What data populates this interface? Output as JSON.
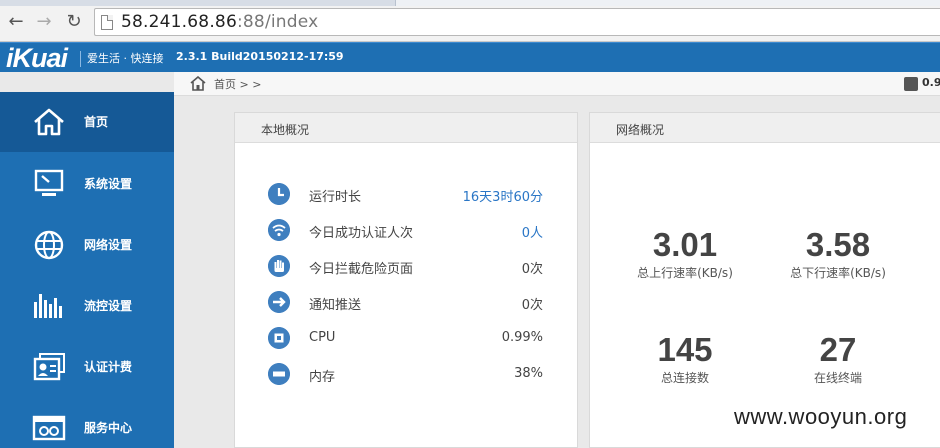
{
  "browser": {
    "url_host": "58.241.68.86",
    "url_port": ":88",
    "url_path": "/index"
  },
  "header": {
    "logo": "iKuai",
    "slogan": "爱生活 · 快连接",
    "build": "2.3.1 Build20150212-17:59"
  },
  "breadcrumb": {
    "text": "首页 > >",
    "cpu_value": "0.9"
  },
  "sidebar": {
    "items": [
      {
        "label": "首页",
        "icon": "home-icon"
      },
      {
        "label": "系统设置",
        "icon": "monitor-icon"
      },
      {
        "label": "网络设置",
        "icon": "globe-icon"
      },
      {
        "label": "流控设置",
        "icon": "bar-chart-icon"
      },
      {
        "label": "认证计费",
        "icon": "id-card-icon"
      },
      {
        "label": "服务中心",
        "icon": "service-window-icon"
      }
    ]
  },
  "local": {
    "title": "本地概况",
    "rows": [
      {
        "label": "运行时长",
        "value": "16天3时60分",
        "icon": "clock-icon"
      },
      {
        "label": "今日成功认证人次",
        "value": "0人",
        "icon": "wifi-icon"
      },
      {
        "label": "今日拦截危险页面",
        "value": "0次",
        "icon": "hand-icon"
      },
      {
        "label": "通知推送",
        "value": "0次",
        "icon": "arrow-right-icon"
      },
      {
        "label": "CPU",
        "value": "0.99%",
        "icon": "cpu-icon"
      },
      {
        "label": "内存",
        "value": "38%",
        "icon": "memory-icon"
      }
    ]
  },
  "network": {
    "title": "网络概况",
    "metrics": [
      {
        "value": "3.01",
        "label": "总上行速率(KB/s)"
      },
      {
        "value": "3.58",
        "label": "总下行速率(KB/s)"
      },
      {
        "value": "145",
        "label": "总连接数"
      },
      {
        "value": "27",
        "label": "在线终端"
      }
    ]
  },
  "watermark": "www.wooyun.org",
  "colors": {
    "brand_blue": "#1e6fb3",
    "active_blue": "#155996",
    "value_blue": "#2a76c6"
  }
}
